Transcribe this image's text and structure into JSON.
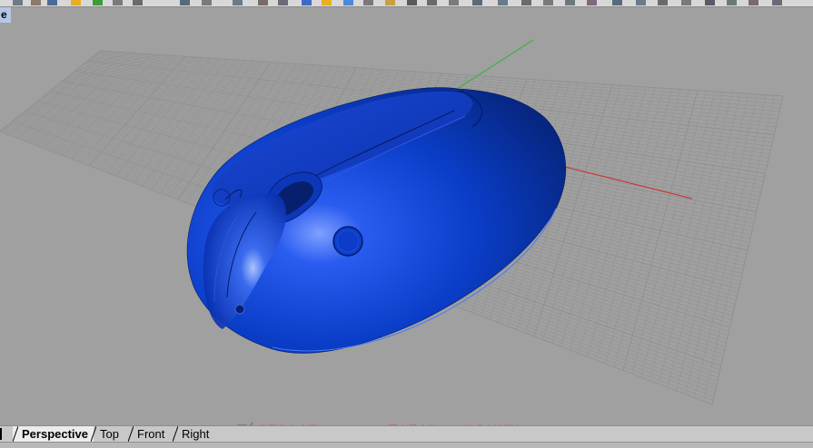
{
  "viewport": {
    "title": "e",
    "background": "#a0a0a0",
    "grid_color": "#8f8f8f",
    "model_color": "#0a3dc8"
  },
  "tabs": [
    {
      "label": "Perspective",
      "active": true
    },
    {
      "label": "Top",
      "active": false
    },
    {
      "label": "Front",
      "active": false
    },
    {
      "label": "Right",
      "active": false
    }
  ],
  "watermark": {
    "text": "学犀牛中文网 xuexiniu.com - 国内最大的Rhino技术交流平台"
  },
  "axes": {
    "x_color": "#c83c3c",
    "y_color": "#3cb43c"
  }
}
